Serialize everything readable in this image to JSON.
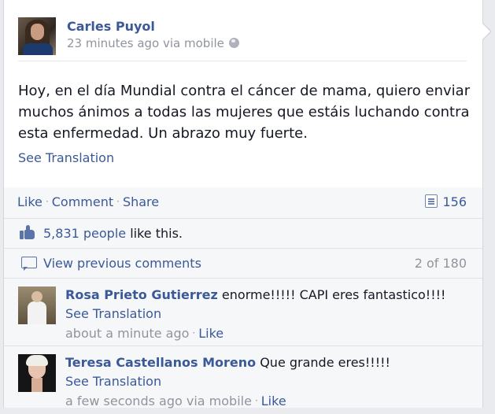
{
  "post": {
    "author": "Carles Puyol",
    "meta": "23 minutes ago via mobile",
    "privacy_icon": "globe-icon",
    "text": "Hoy, en el día Mundial contra el cáncer de mama, quiero enviar muchos ánimos a todas las mujeres que estáis luchando contra esta enfermedad. Un abrazo muy fuerte.",
    "see_translation": "See Translation"
  },
  "actions": {
    "like": "Like",
    "comment": "Comment",
    "share": "Share",
    "comment_count": "156"
  },
  "likes": {
    "count": "5,831 people",
    "suffix": " like this."
  },
  "previous": {
    "label": "View previous comments",
    "pager": "2 of 180"
  },
  "comments": [
    {
      "name": "Rosa Prieto Gutierrez",
      "text": " enorme!!!!! CAPI eres fantastico!!!!",
      "see_translation": "See Translation",
      "time": "about a minute ago",
      "like": "Like"
    },
    {
      "name": "Teresa Castellanos Moreno",
      "text": " Que grande eres!!!!!",
      "see_translation": "See Translation",
      "time": "a few seconds ago via mobile",
      "like": "Like"
    }
  ]
}
